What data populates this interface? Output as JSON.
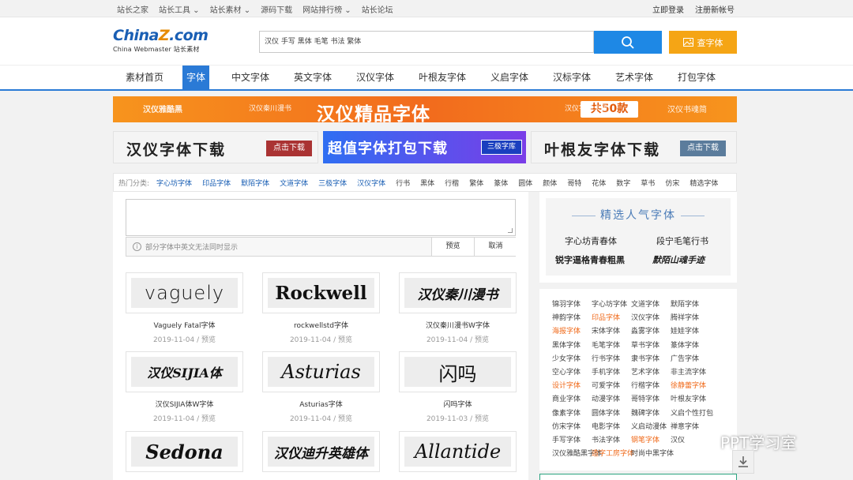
{
  "topbar": {
    "links": [
      "站长之家",
      "站长工具 ⌄",
      "站长素材 ⌄",
      "源码下载",
      "网站排行榜 ⌄",
      "站长论坛"
    ],
    "login": "立即登录",
    "register": "注册新帐号"
  },
  "logo": {
    "brand_a": "China",
    "brand_z": "Z",
    "brand_b": ".com",
    "tagline": "China Webmaster 站长素材"
  },
  "search": {
    "value": "汉仪 手写 黑体 毛笔 书法 繁体",
    "query_label": "查字体"
  },
  "nav": [
    "素材首页",
    "字体",
    "中文字体",
    "英文字体",
    "汉仪字体",
    "叶根友字体",
    "义启字体",
    "汉标字体",
    "艺术字体",
    "打包字体"
  ],
  "banner1": {
    "left": "汉仪雅酷黑",
    "left2": "汉仪秦川漫书",
    "main": "汉仪精品字体",
    "badge": "共50款",
    "right2": "汉仪字研卡通",
    "right": "汉仪书魂简"
  },
  "banner2": {
    "title": "汉仪字体下载",
    "button": "点击下载"
  },
  "banner3": {
    "title": "超值字体打包下载",
    "tag": "三极字库"
  },
  "banner4": {
    "title": "叶根友字体下载",
    "button": "点击下载"
  },
  "hot": {
    "label": "热门分类:",
    "blue": [
      "字心坊字体",
      "印品字体",
      "默陌字体",
      "文道字体",
      "三极字体",
      "汉仪字体"
    ],
    "plain": [
      "行书",
      "黑体",
      "行楷",
      "繁体",
      "篆体",
      "圆体",
      "颜体",
      "哥特",
      "花体",
      "数字",
      "草书",
      "仿宋",
      "精选字体"
    ]
  },
  "editor": {
    "info": "部分字体中英文无法同时显示",
    "preview": "预览",
    "cancel": "取消"
  },
  "fonts": [
    {
      "sample": "vaguely",
      "name": "Vaguely Fatal字体",
      "date": "2019-11-04",
      "action": "预览"
    },
    {
      "sample": "Rockwell",
      "name": "rockwellstd字体",
      "date": "2019-11-04",
      "action": "预览"
    },
    {
      "sample": "汉仪秦川漫书",
      "name": "汉仪秦川漫书W字体",
      "date": "2019-11-04",
      "action": "预览"
    },
    {
      "sample": "汉仪SIJIA体",
      "name": "汉仪SIJIA体W字体",
      "date": "2019-11-04",
      "action": "预览"
    },
    {
      "sample": "Asturias",
      "name": "Asturias字体",
      "date": "2019-11-04",
      "action": "预览"
    },
    {
      "sample": "闪吗",
      "name": "闪吗字体",
      "date": "2019-11-03",
      "action": "预览"
    },
    {
      "sample": "Sedona",
      "name": "",
      "date": "",
      "action": ""
    },
    {
      "sample": "汉仪迪升英雄体",
      "name": "",
      "date": "",
      "action": ""
    },
    {
      "sample": "Allantide",
      "name": "",
      "date": "",
      "action": ""
    }
  ],
  "sidebar": {
    "title": "精选人气字体",
    "featured": [
      "字心坊青春体",
      "段宁毛笔行书",
      "锐字逼格青春粗黑",
      "默陌山魂手迹"
    ],
    "list": [
      [
        "锦羽字体",
        "字心坊字体",
        "文道字体",
        "默陌字体"
      ],
      [
        "神韵字体",
        "印品字体",
        "汉仪字体",
        "腾祥字体"
      ],
      [
        "海报字体",
        "宋体字体",
        "淼雾字体",
        "娃娃字体"
      ],
      [
        "黑体字体",
        "毛笔字体",
        "草书字体",
        "篆体字体"
      ],
      [
        "少女字体",
        "行书字体",
        "隶书字体",
        "广告字体"
      ],
      [
        "空心字体",
        "手机字体",
        "艺术字体",
        "非主流字体"
      ],
      [
        "设计字体",
        "可爱字体",
        "行楷字体",
        "徐静蕾字体"
      ],
      [
        "商业字体",
        "动漫字体",
        "哥特字体",
        "叶根友字体"
      ],
      [
        "像素字体",
        "圆体字体",
        "魏碑字体",
        "义启个性打包"
      ],
      [
        "仿宋字体",
        "电影字体",
        "义启动漫体",
        "禅意字体"
      ],
      [
        "手写字体",
        "书法字体",
        "钢笔字体",
        "汉仪"
      ],
      [
        "汉仪雅酷黑字体",
        "造字工房字体",
        "时尚中黑字体"
      ]
    ],
    "orange": [
      "印品字体",
      "海报字体",
      "设计字体",
      "徐静蕾字体",
      "钢笔字体",
      "造字工房字体"
    ]
  },
  "watermark": "PPT学习室"
}
